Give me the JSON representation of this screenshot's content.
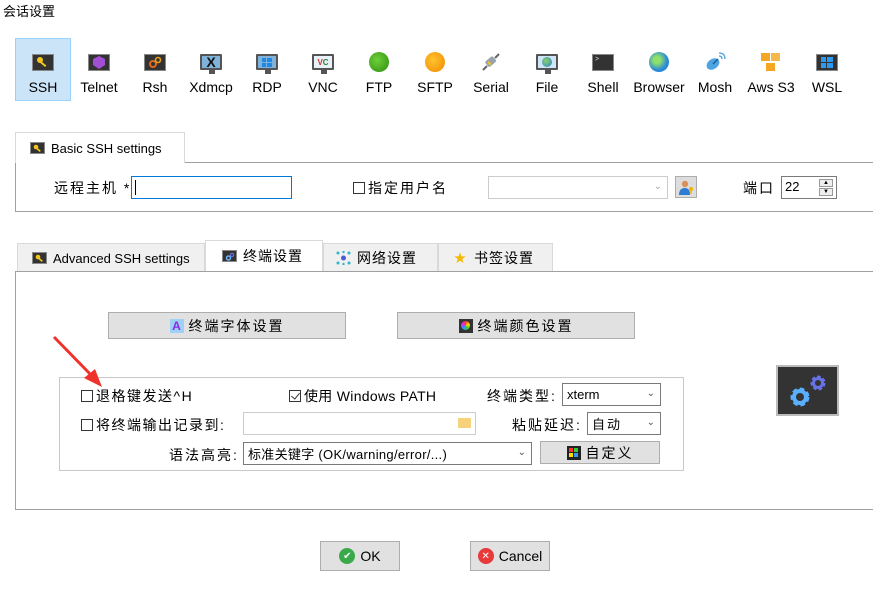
{
  "window": {
    "title": "会话设置"
  },
  "session_types": [
    {
      "label": "SSH",
      "icon": "key-icon",
      "selected": true
    },
    {
      "label": "Telnet",
      "icon": "telnet-gem-icon",
      "selected": false
    },
    {
      "label": "Rsh",
      "icon": "rsh-gears-icon",
      "selected": false
    },
    {
      "label": "Xdmcp",
      "icon": "xdmcp-monitor-icon",
      "selected": false
    },
    {
      "label": "RDP",
      "icon": "rdp-windows-monitor-icon",
      "selected": false
    },
    {
      "label": "VNC",
      "icon": "vnc-monitor-icon",
      "selected": false
    },
    {
      "label": "FTP",
      "icon": "green-globe-icon",
      "selected": false
    },
    {
      "label": "SFTP",
      "icon": "orange-globe-icon",
      "selected": false
    },
    {
      "label": "Serial",
      "icon": "serial-plug-icon",
      "selected": false
    },
    {
      "label": "File",
      "icon": "file-monitor-globe-icon",
      "selected": false
    },
    {
      "label": "Shell",
      "icon": "terminal-icon",
      "selected": false
    },
    {
      "label": "Browser",
      "icon": "browser-globe-icon",
      "selected": false
    },
    {
      "label": "Mosh",
      "icon": "satellite-dish-icon",
      "selected": false
    },
    {
      "label": "Aws S3",
      "icon": "aws-cubes-icon",
      "selected": false
    },
    {
      "label": "WSL",
      "icon": "windows-logo-icon",
      "selected": false
    }
  ],
  "basic": {
    "tab_label": "Basic SSH settings",
    "remote_host_label": "远程主机 *",
    "remote_host_value": "",
    "specify_user_label": "指定用户名",
    "specify_user_checked": false,
    "username_value": "",
    "port_label": "端口",
    "port_value": "22"
  },
  "advanced_tabs": [
    {
      "label": "Advanced SSH settings",
      "icon": "key-icon",
      "active": false
    },
    {
      "label": "终端设置",
      "icon": "gears-icon",
      "active": true
    },
    {
      "label": "网络设置",
      "icon": "network-icon",
      "active": false
    },
    {
      "label": "书签设置",
      "icon": "star-icon",
      "active": false
    }
  ],
  "terminal": {
    "font_button": "终端字体设置",
    "color_button": "终端颜色设置",
    "backspace_label": "退格键发送^H",
    "backspace_checked": false,
    "windows_path_label": "使用 Windows PATH",
    "windows_path_checked": true,
    "term_type_label": "终端类型:",
    "term_type_value": "xterm",
    "log_output_label": "将终端输出记录到:",
    "log_output_checked": false,
    "log_path_value": "",
    "paste_delay_label": "粘贴延迟:",
    "paste_delay_value": "自动",
    "syntax_label": "语法高亮:",
    "syntax_value": "标准关键字 (OK/warning/error/...)",
    "customize_button": "自定义"
  },
  "footer": {
    "ok_label": "OK",
    "cancel_label": "Cancel"
  }
}
